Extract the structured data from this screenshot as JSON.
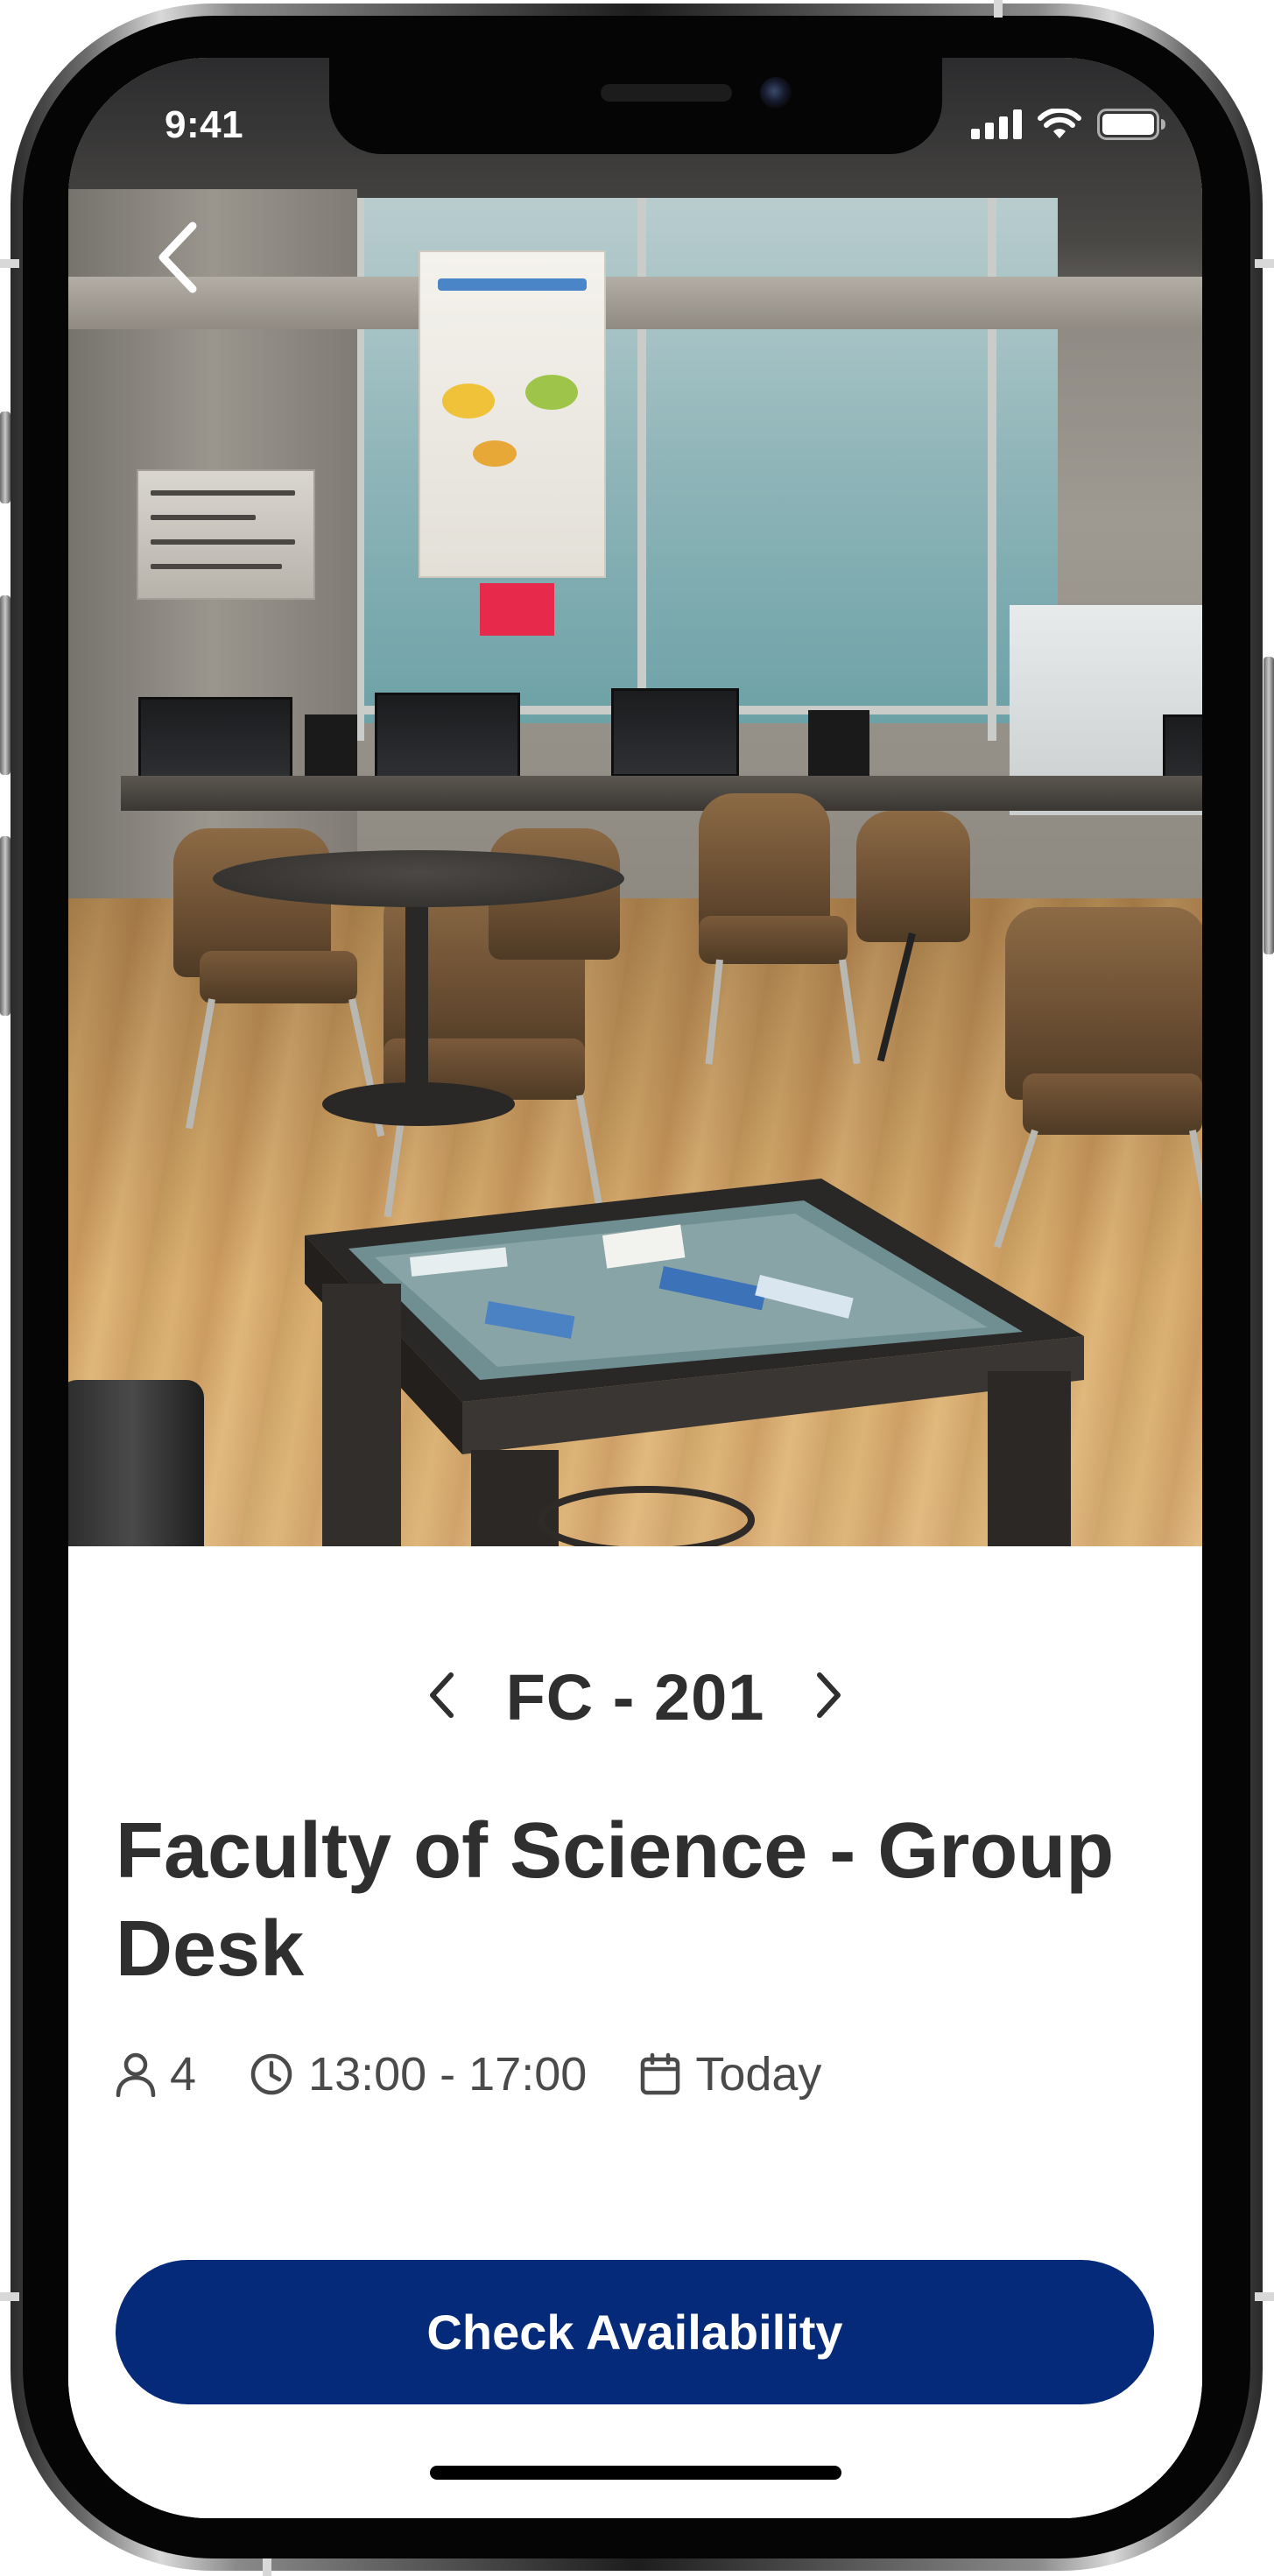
{
  "status_bar": {
    "time": "9:41",
    "icons": [
      "cellular-signal-icon",
      "wifi-icon",
      "battery-icon"
    ]
  },
  "hero_photo": {
    "icon": "study-room-photo",
    "back_icon": "chevron-left-icon"
  },
  "room": {
    "code": "FC - 201",
    "prev_icon": "chevron-left-icon",
    "next_icon": "chevron-right-icon",
    "title": "Faculty of Science - Group Desk",
    "capacity": "4",
    "time_range": "13:00 - 17:00",
    "date": "Today",
    "capacity_icon": "person-icon",
    "time_icon": "clock-icon",
    "date_icon": "calendar-icon"
  },
  "actions": {
    "check_availability_label": "Check Availability"
  },
  "colors": {
    "primary": "#062a7a",
    "text_dark": "#2f2f2f",
    "text_muted": "#4a4a4a",
    "background": "#ffffff"
  }
}
